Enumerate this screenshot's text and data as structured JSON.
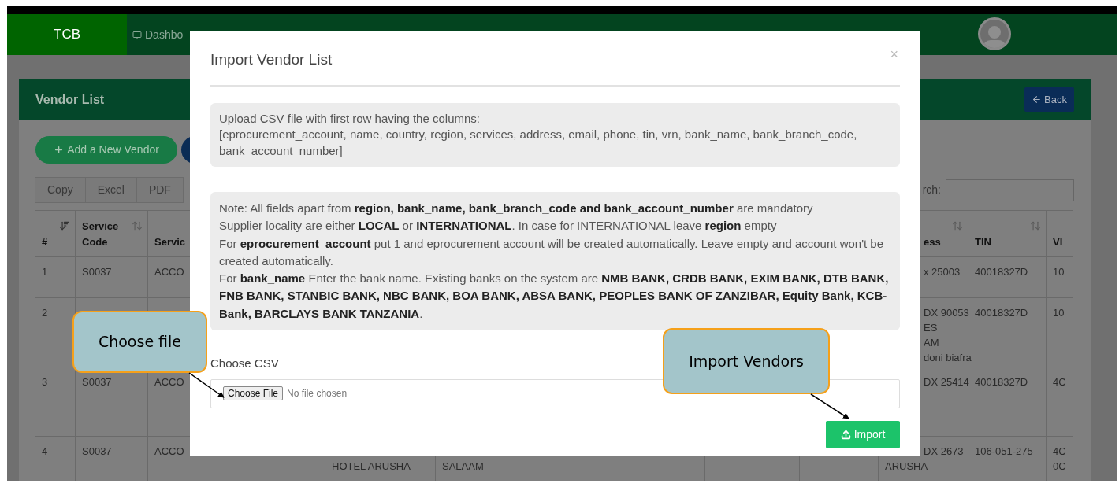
{
  "navbar": {
    "brand": "TCB",
    "items": [
      {
        "label": "Dashbo"
      }
    ]
  },
  "page": {
    "title": "Vendor List",
    "back_button": "Back",
    "add_button": "Add a New Vendor",
    "export_buttons": [
      "Copy",
      "Excel",
      "PDF"
    ],
    "search_label": "rch:"
  },
  "table": {
    "columns": [
      {
        "label": "#",
        "sorted": true
      },
      {
        "label": "Service Code",
        "sorted": false
      },
      {
        "label": "Servic"
      },
      {
        "label": "ess",
        "sorted": false
      },
      {
        "label": "TIN",
        "sorted": false
      },
      {
        "label": "VI"
      }
    ],
    "rows": [
      {
        "number": "1",
        "service_code": "S0037",
        "service": "ACCO",
        "address": [
          "x 25003"
        ],
        "tin": "40018327D",
        "column_11": [
          "10"
        ]
      },
      {
        "number": "2",
        "address": [
          "DX 90053",
          "ES",
          "AM",
          "doni biafra"
        ],
        "tin": "40018327D",
        "column_11": [
          "10"
        ]
      },
      {
        "number": "3",
        "service_code": "S0037",
        "service": "ACCO",
        "address": [
          "DX 25414"
        ],
        "tin": "40018327D",
        "column_11": [
          "4C"
        ]
      },
      {
        "number": "4",
        "service_code": "S0037",
        "service": "ACCO",
        "column_4": "HOTEL ARUSHA",
        "column_5": "SALAAM",
        "address": [
          "DX 2673",
          "ARUSHA"
        ],
        "tin": "106-051-275",
        "column_11": [
          "4C",
          "0C"
        ]
      }
    ]
  },
  "modal": {
    "title": "Import Vendor List",
    "close": "×",
    "instructions": [
      "Upload CSV file with first row having the columns:",
      "[eprocurement_account, name, country, region, services, address, email, phone, tin, vrn, bank_name, bank_branch_code, bank_account_number]"
    ],
    "notes": [
      "Note: All fields apart from **region, bank_name, bank_branch_code and bank_account_number** are mandatory",
      "Supplier locality are either **LOCAL** or **INTERNATIONAL**. In case for INTERNATIONAL leave **region** empty",
      "For **eprocurement_account** put 1 and eprocurement account will be created automatically. Leave empty and account won't be created automatically.",
      "For **bank_name** Enter the bank name. Existing banks on the system are **NMB BANK, CRDB BANK, EXIM BANK, DTB BANK, FNB BANK, STANBIC BANK, NBC BANK, BOA BANK, ABSA BANK, PEOPLES BANK OF ZANZIBAR, Equity Bank, KCB-Bank, BARCLAYS BANK TANZANIA**."
    ],
    "file_label": "Choose CSV",
    "file_button": "Choose File",
    "file_status": "No file chosen",
    "import_button": "Import"
  },
  "callouts": [
    {
      "label": "Choose file"
    },
    {
      "label": "Import Vendors"
    }
  ]
}
